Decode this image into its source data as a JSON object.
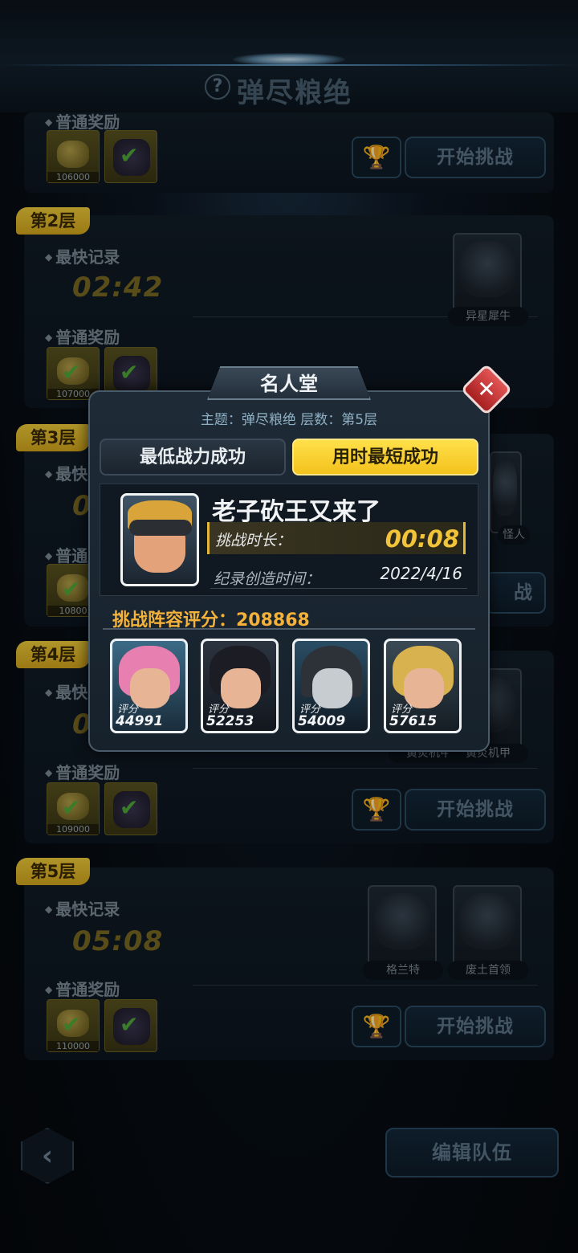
{
  "header": {
    "title": "弹尽粮绝",
    "help_icon": "question-icon"
  },
  "levels": [
    {
      "tag": "",
      "reward_label": "普通奖励",
      "coin_amount": "106000",
      "start_label": "开始挑战"
    },
    {
      "tag": "第2层",
      "record_label": "最快记录",
      "record_time": "02:42",
      "reward_label": "普通奖励",
      "coin_amount": "107000",
      "boss_name": "异星犀牛",
      "start_label": "开始挑战"
    },
    {
      "tag": "第3层",
      "record_label": "最快",
      "record_time": "0",
      "reward_label": "普通",
      "coin_amount": "10800",
      "boss_name": "怪人",
      "start_label": "战"
    },
    {
      "tag": "第4层",
      "record_label": "最快",
      "record_time": "0",
      "reward_label": "普通奖励",
      "coin_amount": "109000",
      "boss_names": [
        "黄炎机甲",
        "黄炎机甲"
      ],
      "start_label": "开始挑战"
    },
    {
      "tag": "第5层",
      "record_label": "最快记录",
      "record_time": "05:08",
      "reward_label": "普通奖励",
      "coin_amount": "110000",
      "boss_names": [
        "格兰特",
        "废土首领"
      ],
      "start_label": "开始挑战"
    }
  ],
  "bottom": {
    "back_icon": "chevron-left-icon",
    "edit_team_label": "编辑队伍"
  },
  "modal": {
    "title": "名人堂",
    "close_icon": "close-icon",
    "subtitle": "主题：弹尽粮绝 层数：第5层",
    "tabs": [
      {
        "label": "最低战力成功",
        "active": false
      },
      {
        "label": "用时最短成功",
        "active": true
      }
    ],
    "player_name": "老子砍王又来了",
    "duration_label": "挑战时长：",
    "duration_value": "00:08",
    "created_label": "纪录创造时间：",
    "created_value": "2022/4/16",
    "lineup_score": "挑战阵容评分：208868",
    "heroes": [
      {
        "score_label": "评分",
        "score": "44991",
        "hair_color": "#e77fb0"
      },
      {
        "score_label": "评分",
        "score": "52253",
        "hair_color": "#1c1d24"
      },
      {
        "score_label": "评分",
        "score": "54009",
        "hair_color": "#2d3138"
      },
      {
        "score_label": "评分",
        "score": "57615",
        "hair_color": "#d8b24e"
      }
    ]
  },
  "colors": {
    "accent_yellow": "#f3c21c",
    "close_red": "#c62f2f",
    "score_orange": "#f4b23a"
  }
}
